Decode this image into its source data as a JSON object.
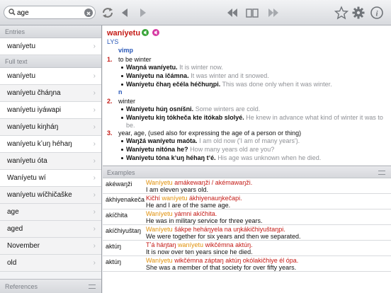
{
  "search": {
    "value": "age"
  },
  "sidebar": {
    "entries_header": "Entries",
    "entries": [
      "waníyetu"
    ],
    "fulltext_header": "Full text",
    "fulltext": [
      "waníyetu",
      "waníyetu čháŋna",
      "waníyetu iyáwapi",
      "waníyetu kiŋháŋ",
      "waníyetu kʼuŋ héhaŋ",
      "waníyetu óta",
      "Waníyetu wí",
      "waníyetu wíčhičaške"
    ],
    "words": [
      "age",
      "aged",
      "November",
      "old"
    ],
    "references_header": "References"
  },
  "entry": {
    "headword": "waníyetu",
    "dictionary": "LYS",
    "senses": [
      {
        "pos": "vimp",
        "num": "1.",
        "gloss": "to be winter",
        "examples": [
          {
            "lak": "Waŋná waníyetu.",
            "eng": "It is winter now."
          },
          {
            "lak": "Waníyetu na ičámna.",
            "eng": "It was winter and it snowed."
          },
          {
            "lak": "Waníyetu čhaŋ ečéla héčhuŋpi.",
            "eng": "This was done only when it was winter."
          }
        ]
      },
      {
        "pos": "n",
        "num": "2.",
        "gloss": "winter",
        "examples": [
          {
            "lak": "Waníyetu húŋ osníšni.",
            "eng": "Some winters are cold."
          },
          {
            "lak": "Waníyetu kiŋ tókheča kte itókab slolyé.",
            "eng": "He knew in advance what kind of winter it was to",
            "eng2": "be."
          }
        ]
      },
      {
        "num": "3.",
        "gloss": "year, age, (used also for expressing the age of a person or thing)",
        "examples": [
          {
            "lak": "Waŋžá waníyetu maóta.",
            "eng": "I am old now ('I am of many years')."
          },
          {
            "lak": "Waníyetu nitóna he?",
            "eng": "How many years old are you?"
          },
          {
            "lak": "Waníyetu tóna kʼuŋ héhaŋ tʼé.",
            "eng": "His age was unknown when he died."
          }
        ]
      }
    ]
  },
  "examples_panel": {
    "header": "Examples",
    "rows": [
      {
        "word": "akéwaŋži",
        "hl": "Waníyetu",
        "rest": " amákewaŋži / akémawaŋži.",
        "eng": "I am eleven years old."
      },
      {
        "word": "ákhiyenakeča",
        "pre": "Kičhí ",
        "hl": "waníyetu",
        "rest": " ákhiyenauŋkečapi.",
        "eng": "He and I are of the same age."
      },
      {
        "word": "akíčhita",
        "hl": "Waníyetu",
        "rest": " yámni akíčhita.",
        "eng": "He was in military service for three years."
      },
      {
        "word": "akíčhiyuštaŋ",
        "hl": "Waníyetu",
        "rest": " šákpe heháŋyela na uŋkákičhiyuštaŋpi.",
        "eng": "We were together for six years and then we separated."
      },
      {
        "word": "aktúŋ",
        "pre": "Tʼá háŋtaŋ ",
        "hl": "waníyetu",
        "rest": " wikčémna aktúŋ.",
        "eng": "It is now over ten years since he died."
      },
      {
        "word": "aktúŋ",
        "hl": "Waníyetu",
        "rest": " wikčémna záptaŋ aktúŋ okólakičhiye él ópa.",
        "eng": "She was a member of that society for over fifty years."
      }
    ]
  },
  "colors": {
    "headword": "#c41a15",
    "link": "#2a58b8",
    "highlight": "#e0900a",
    "speaker_green": "#3aa53a",
    "speaker_pink": "#d63aa3"
  }
}
